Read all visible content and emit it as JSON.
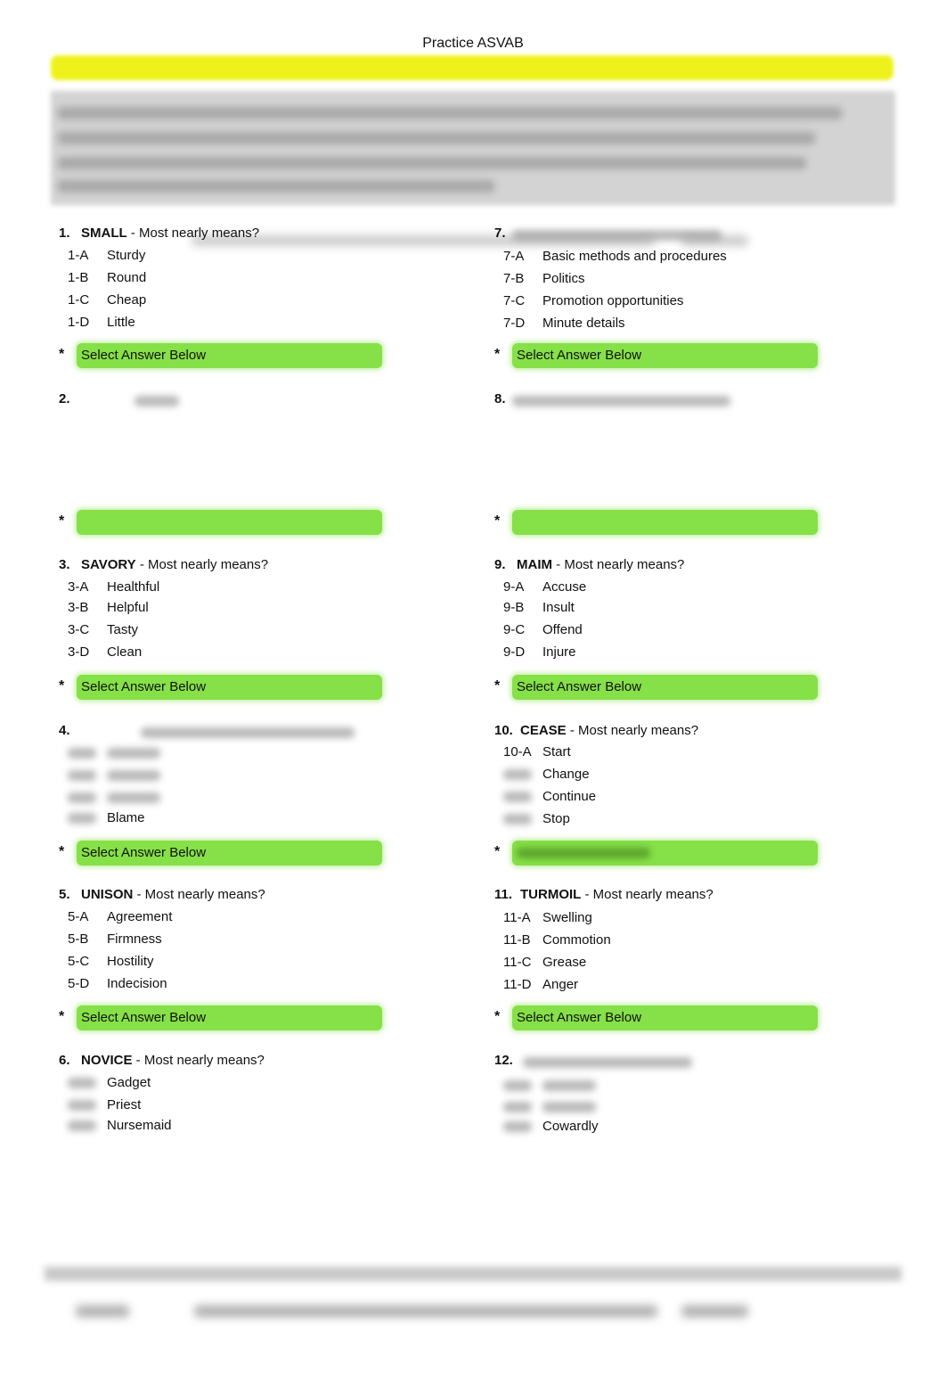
{
  "document": {
    "title": "Practice ASVAB",
    "accent_colors": {
      "header_bar": "#eef21a",
      "instructions_bg": "#d3d3d3",
      "answer_field": "#86e047"
    }
  },
  "answer_marker": "*",
  "questions": [
    {
      "number": "1.",
      "word": "SMALL",
      "prompt": " - Most nearly means?",
      "options": [
        {
          "label": "1-A",
          "text": "Sturdy"
        },
        {
          "label": "1-B",
          "text": "Round"
        },
        {
          "label": "1-C",
          "text": "Cheap"
        },
        {
          "label": "1-D",
          "text": "Little"
        }
      ],
      "answer_placeholder": "Select Answer Below"
    },
    {
      "number": "2.",
      "word": "",
      "prompt": "",
      "options": [],
      "answer_placeholder": ""
    },
    {
      "number": "3.",
      "word": "SAVORY",
      "prompt": " - Most nearly means?",
      "options": [
        {
          "label": "3-A",
          "text": "Healthful"
        },
        {
          "label": "3-B",
          "text": "Helpful"
        },
        {
          "label": "3-C",
          "text": "Tasty"
        },
        {
          "label": "3-D",
          "text": "Clean"
        }
      ],
      "answer_placeholder": "Select Answer Below"
    },
    {
      "number": "4.",
      "word": "",
      "prompt": "",
      "options": [
        {
          "label": "",
          "text": ""
        },
        {
          "label": "",
          "text": ""
        },
        {
          "label": "",
          "text": ""
        },
        {
          "label": "",
          "text": "Blame"
        }
      ],
      "answer_placeholder": "Select Answer Below"
    },
    {
      "number": "5.",
      "word": "UNISON",
      "prompt": " - Most nearly means?",
      "options": [
        {
          "label": "5-A",
          "text": "Agreement"
        },
        {
          "label": "5-B",
          "text": "Firmness"
        },
        {
          "label": "5-C",
          "text": "Hostility"
        },
        {
          "label": "5-D",
          "text": "Indecision"
        }
      ],
      "answer_placeholder": "Select Answer Below"
    },
    {
      "number": "6.",
      "word": "NOVICE",
      "prompt": " - Most nearly means?",
      "options": [
        {
          "label": "",
          "text": "Gadget"
        },
        {
          "label": "",
          "text": "Priest"
        },
        {
          "label": "",
          "text": "Nursemaid"
        }
      ],
      "answer_placeholder": ""
    },
    {
      "number": "7.",
      "word": "",
      "prompt": "",
      "options": [
        {
          "label": "7-A",
          "text": "Basic methods and procedures"
        },
        {
          "label": "7-B",
          "text": "Politics"
        },
        {
          "label": "7-C",
          "text": "Promotion opportunities"
        },
        {
          "label": "7-D",
          "text": "Minute details"
        }
      ],
      "answer_placeholder": "Select Answer Below"
    },
    {
      "number": "8.",
      "word": "",
      "prompt": "",
      "options": [],
      "answer_placeholder": ""
    },
    {
      "number": "9.",
      "word": "MAIM",
      "prompt": " - Most nearly means?",
      "options": [
        {
          "label": "9-A",
          "text": "Accuse"
        },
        {
          "label": "9-B",
          "text": "Insult"
        },
        {
          "label": "9-C",
          "text": "Offend"
        },
        {
          "label": "9-D",
          "text": "Injure"
        }
      ],
      "answer_placeholder": "Select Answer Below"
    },
    {
      "number": "10.",
      "word": "CEASE",
      "prompt": " - Most nearly means?",
      "options": [
        {
          "label": "10-A",
          "text": "Start"
        },
        {
          "label": "",
          "text": "Change"
        },
        {
          "label": "",
          "text": "Continue"
        },
        {
          "label": "",
          "text": "Stop"
        }
      ],
      "answer_placeholder": ""
    },
    {
      "number": "11.",
      "word": "TURMOIL",
      "prompt": " - Most nearly means?",
      "options": [
        {
          "label": "11-A",
          "text": "Swelling"
        },
        {
          "label": "11-B",
          "text": "Commotion"
        },
        {
          "label": "11-C",
          "text": "Grease"
        },
        {
          "label": "11-D",
          "text": "Anger"
        }
      ],
      "answer_placeholder": "Select Answer Below"
    },
    {
      "number": "12.",
      "word": "",
      "prompt": "",
      "options": [
        {
          "label": "",
          "text": ""
        },
        {
          "label": "",
          "text": ""
        },
        {
          "label": "",
          "text": "Cowardly"
        }
      ],
      "answer_placeholder": ""
    }
  ]
}
